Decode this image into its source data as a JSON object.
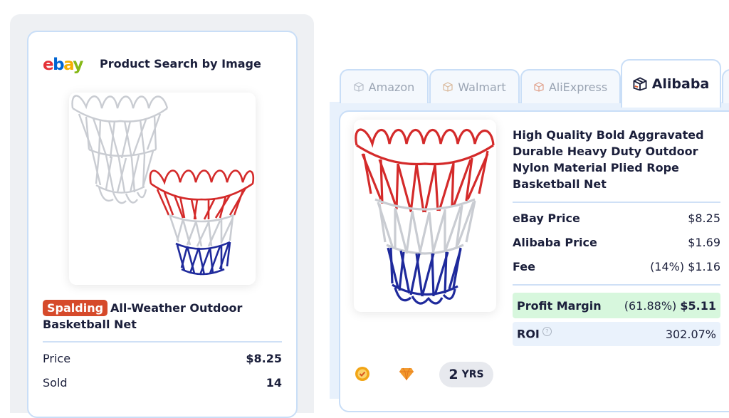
{
  "left_panel": {
    "logo_letters": [
      "e",
      "b",
      "a",
      "y"
    ],
    "title": "Product Search by Image",
    "product": {
      "brand": "Spalding",
      "name": "All-Weather Outdoor Basketball Net"
    },
    "stats": [
      {
        "label": "Price",
        "value": "$8.25"
      },
      {
        "label": "Sold",
        "value": "14"
      }
    ]
  },
  "tabs": [
    {
      "label": "Amazon",
      "active": false
    },
    {
      "label": "Walmart",
      "active": false
    },
    {
      "label": "AliExpress",
      "active": false
    },
    {
      "label": "Alibaba",
      "active": true
    }
  ],
  "right_panel": {
    "title": "High Quality Bold Aggravated Durable Heavy Duty Outdoor Nylon Material Plied Rope Basketball Net",
    "prices": [
      {
        "label": "eBay Price",
        "value": "$8.25"
      },
      {
        "label": "Alibaba Price",
        "value": "$1.69"
      },
      {
        "label": "Fee",
        "value": "(14%) $1.16"
      }
    ],
    "profit": {
      "label": "Profit Margin",
      "percent": "(61.88%)",
      "value": "$5.11"
    },
    "roi": {
      "label": "ROI",
      "help": "?",
      "value": "302.07%"
    },
    "supplier": {
      "years_number": "2",
      "years_unit": "YRS"
    }
  },
  "colors": {
    "accent_border": "#c9def7",
    "profit_bg": "#d7f7dd",
    "brand_badge": "#d64a2b",
    "net_red": "#d42a2a",
    "net_blue": "#1f2a9c"
  }
}
